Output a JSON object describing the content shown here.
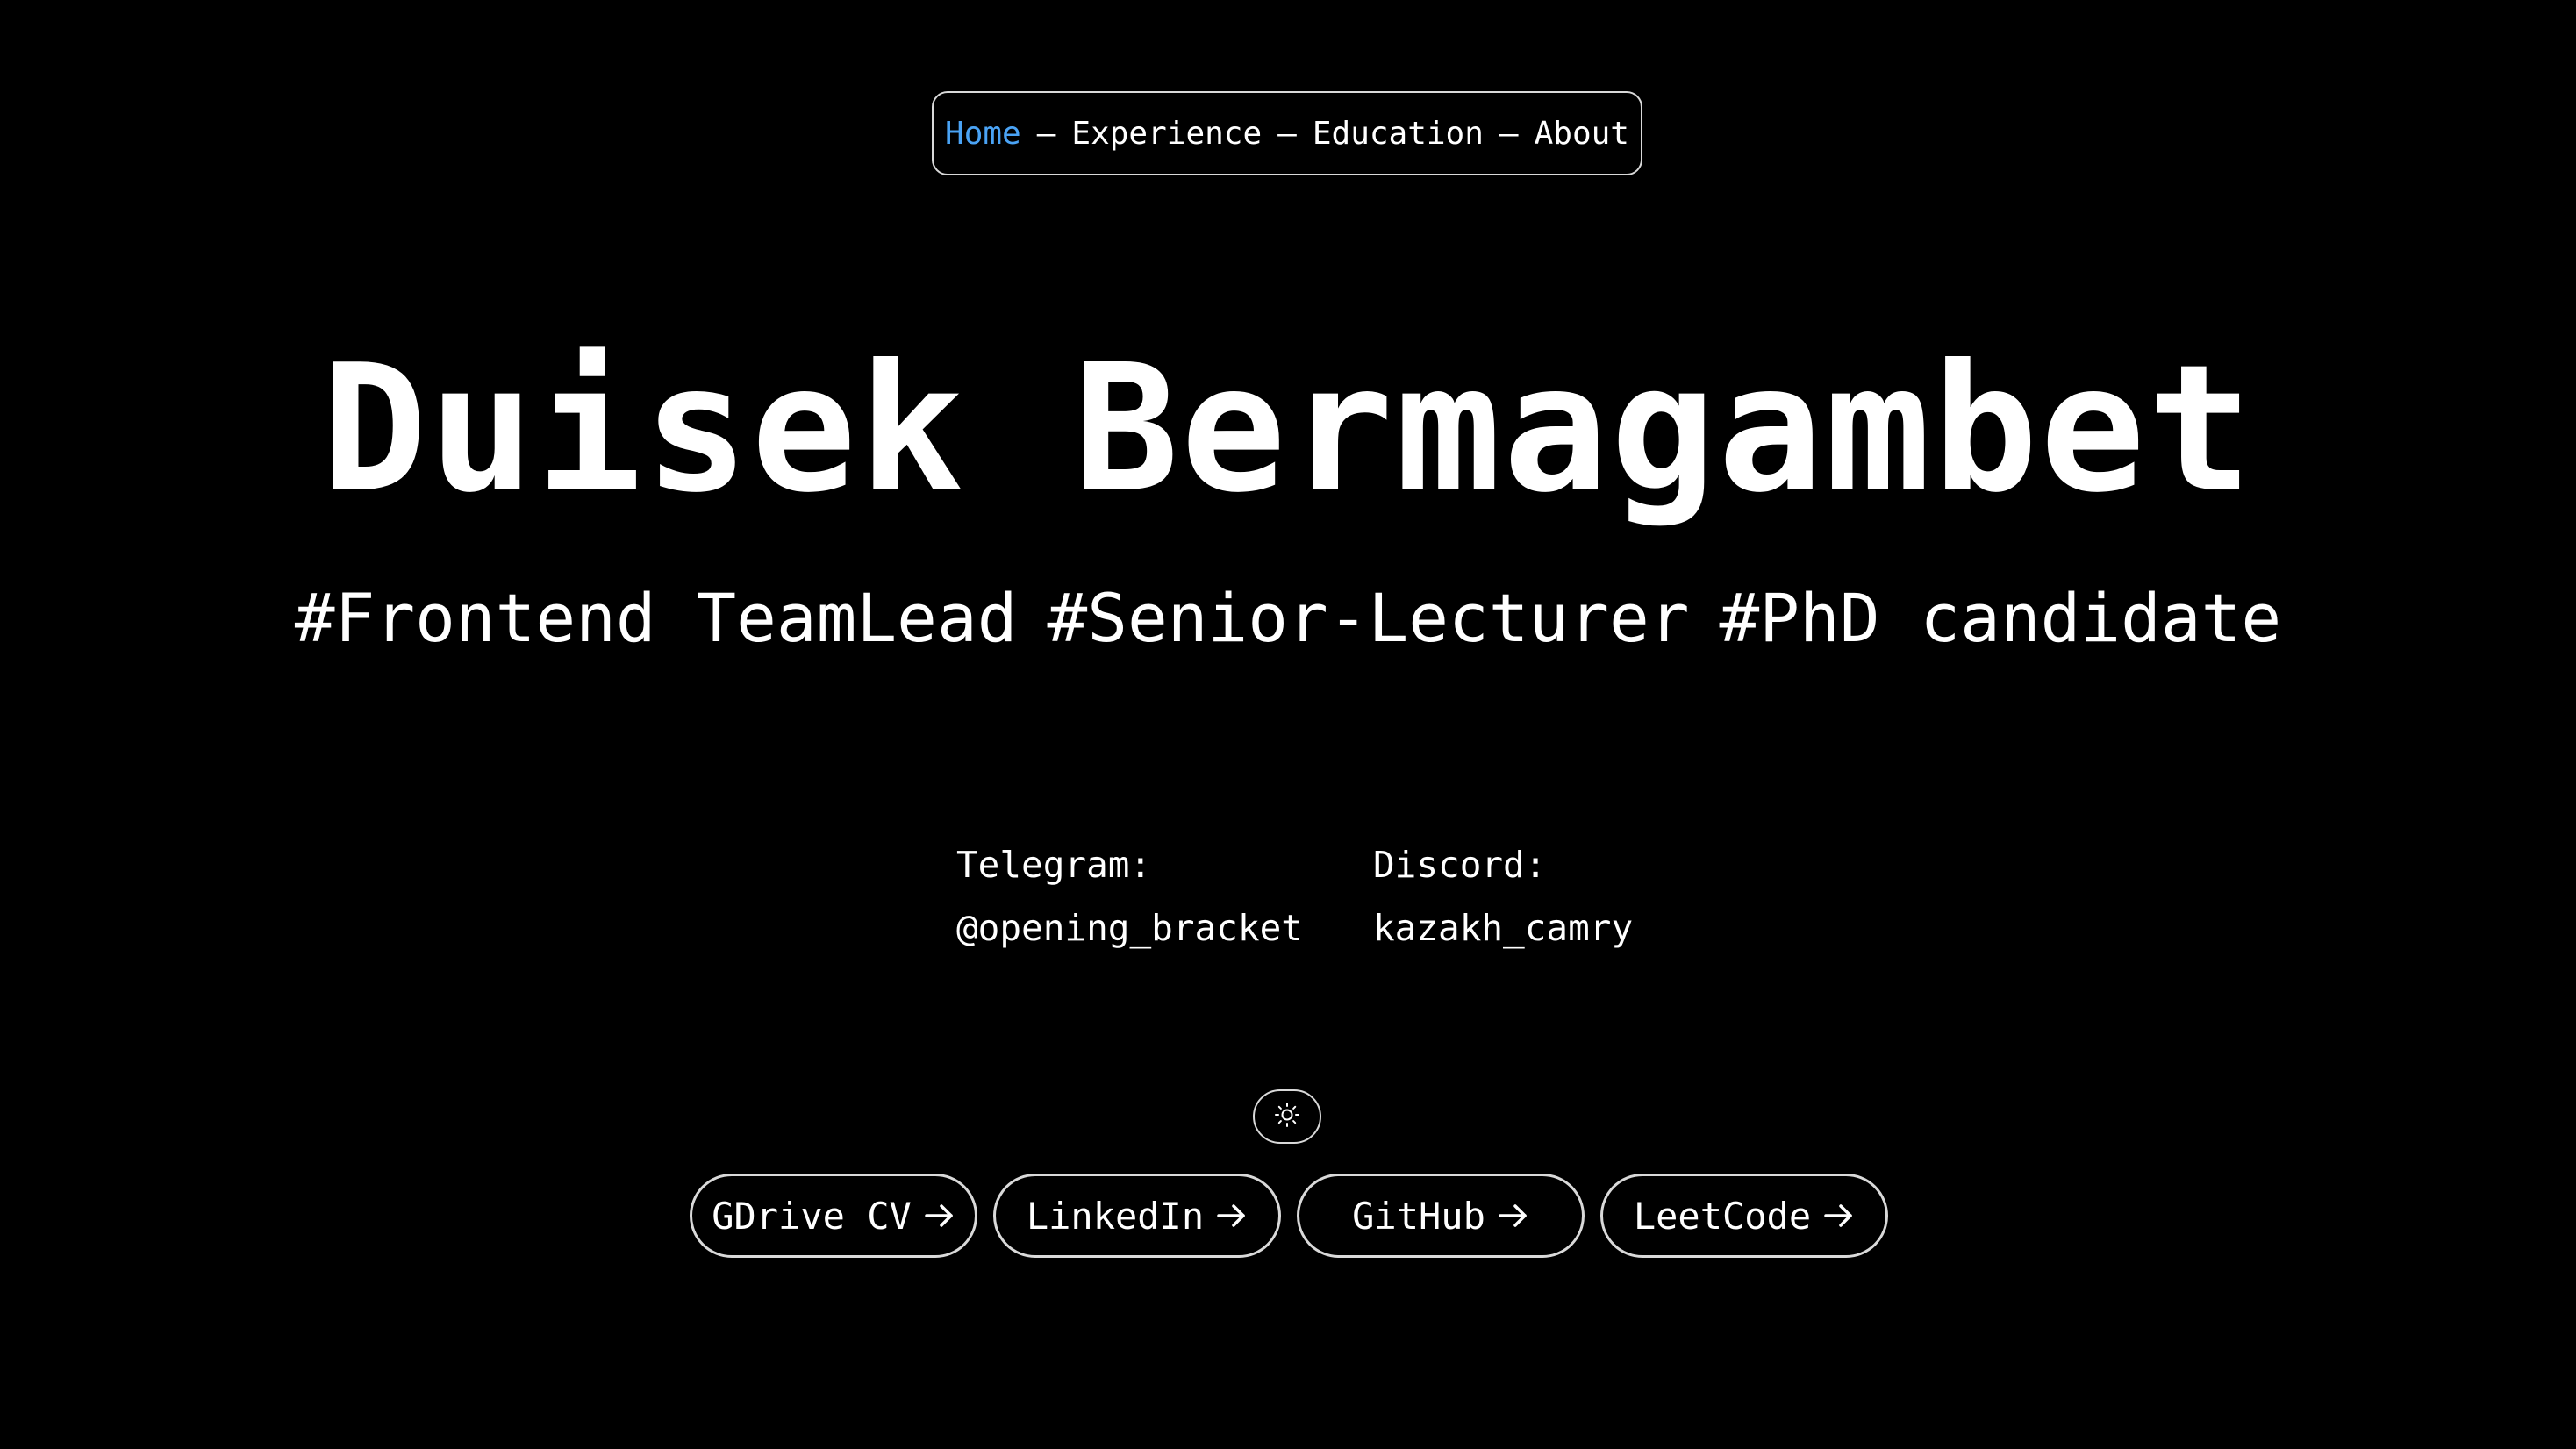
{
  "nav": {
    "items": [
      {
        "label": "Home",
        "active": true
      },
      {
        "label": "Experience",
        "active": false
      },
      {
        "label": "Education",
        "active": false
      },
      {
        "label": "About",
        "active": false
      }
    ],
    "separator": "–",
    "active_color": "#4aa3f5"
  },
  "hero": {
    "name": "Duisek Bermagambet",
    "tags": [
      "#Frontend TeamLead",
      "#Senior-Lecturer",
      "#PhD candidate"
    ]
  },
  "contacts": {
    "telegram": {
      "label": "Telegram:",
      "value": "@opening_bracket"
    },
    "discord": {
      "label": "Discord:",
      "value": "kazakh_camry"
    }
  },
  "theme_toggle": {
    "icon": "sun-icon"
  },
  "links": [
    {
      "label": "GDrive CV",
      "icon": "arrow-right-icon"
    },
    {
      "label": "LinkedIn",
      "icon": "arrow-right-icon"
    },
    {
      "label": "GitHub",
      "icon": "arrow-right-icon"
    },
    {
      "label": "LeetCode",
      "icon": "arrow-right-icon"
    }
  ],
  "colors": {
    "background": "#000000",
    "text": "#ffffff",
    "border": "#d9d9d9"
  }
}
